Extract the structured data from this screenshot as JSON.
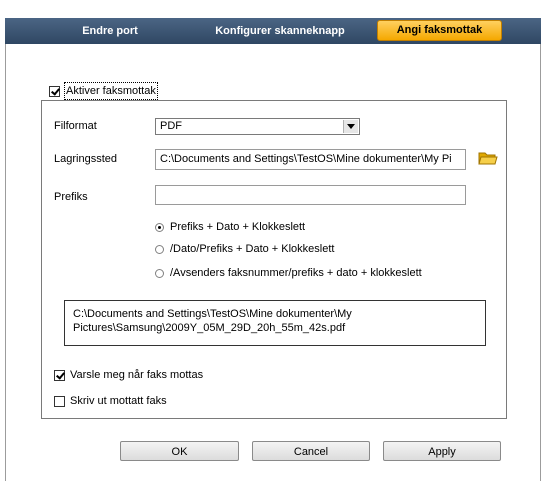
{
  "tabs": [
    {
      "label": "Endre port",
      "active": false
    },
    {
      "label": "Konfigurer skanneknapp",
      "active": false
    },
    {
      "label": "Angi faksmottak",
      "active": true
    }
  ],
  "enable_fax_receive": {
    "label": "Aktiver faksmottak",
    "checked": true
  },
  "file_format": {
    "label": "Filformat",
    "value": "PDF"
  },
  "storage_location": {
    "label": "Lagringssted",
    "value": "C:\\Documents and Settings\\TestOS\\Mine dokumenter\\My Pi"
  },
  "prefix": {
    "label": "Prefiks",
    "value": ""
  },
  "prefix_options": [
    {
      "label": "Prefiks + Dato + Klokkeslett",
      "selected": true
    },
    {
      "label": "/Dato/Prefiks + Dato + Klokkeslett",
      "selected": false
    },
    {
      "label": "/Avsenders faksnummer/prefiks + dato + klokkeslett",
      "selected": false
    }
  ],
  "path_preview": {
    "line1": "C:\\Documents and Settings\\TestOS\\Mine dokumenter\\My",
    "line2": "Pictures\\Samsung\\2009Y_05M_29D_20h_55m_42s.pdf"
  },
  "notify_on_receive": {
    "label": "Varsle meg når faks mottas",
    "checked": true
  },
  "print_received": {
    "label": "Skriv ut mottatt faks",
    "checked": false
  },
  "buttons": {
    "ok": "OK",
    "cancel": "Cancel",
    "apply": "Apply"
  },
  "colors": {
    "tab_bar": "#3d5572",
    "active_tab": "#f5b400",
    "folder": "#f2c94c"
  },
  "icons": {
    "folder": "folder-icon",
    "dropdown": "chevron-down-icon"
  }
}
